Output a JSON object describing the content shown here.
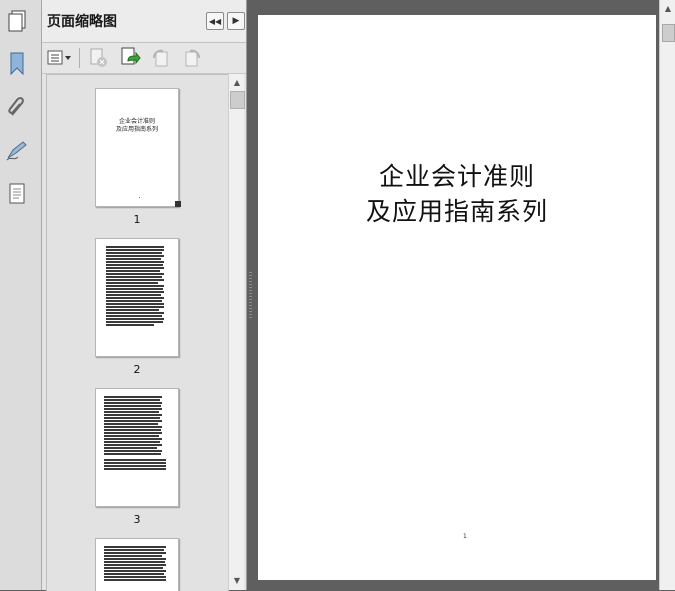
{
  "panel": {
    "title": "页面缩略图"
  },
  "rail": {
    "icons": [
      "pages-icon",
      "bookmark-icon",
      "attachment-icon",
      "signature-icon",
      "content-icon"
    ]
  },
  "toolbar": {
    "icons": [
      "options-menu-icon",
      "delete-page-icon",
      "extract-page-icon",
      "rotate-left-icon",
      "rotate-right-icon"
    ]
  },
  "thumbnails": [
    {
      "page_label": "1",
      "title_line1": "企业会计准则",
      "title_line2": "及应用指南系列"
    },
    {
      "page_label": "2"
    },
    {
      "page_label": "3"
    }
  ],
  "document": {
    "title_line1": "企业会计准则",
    "title_line2": "及应用指南系列",
    "page_number": "1"
  },
  "colors": {
    "panel_bg": "#e4e4e4",
    "doc_bg": "#5f5f5f",
    "page_bg": "#ffffff"
  }
}
